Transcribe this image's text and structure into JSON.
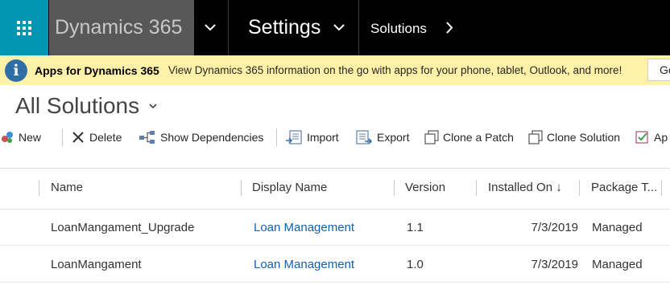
{
  "nav": {
    "brand": "Dynamics 365",
    "area": "Settings",
    "breadcrumb": "Solutions"
  },
  "banner": {
    "title": "Apps for Dynamics 365",
    "message": "View Dynamics 365 information on the go with apps for your phone, tablet, Outlook, and more!",
    "button_label": "Ge"
  },
  "view": {
    "title": "All Solutions"
  },
  "commands": {
    "new": "New",
    "delete": "Delete",
    "show_dependencies": "Show Dependencies",
    "import": "Import",
    "export": "Export",
    "clone_patch": "Clone a Patch",
    "clone_solution": "Clone Solution",
    "apply": "Ap"
  },
  "grid": {
    "columns": [
      "Name",
      "Display Name",
      "Version",
      "Installed On",
      "Package T..."
    ],
    "sort_indicator": "↓",
    "rows": [
      {
        "name": "LoanMangament_Upgrade",
        "display_name": "Loan Management",
        "version": "1.1",
        "installed_on": "7/3/2019",
        "package_type": "Managed"
      },
      {
        "name": "LoanMangament",
        "display_name": "Loan Management",
        "version": "1.0",
        "installed_on": "7/3/2019",
        "package_type": "Managed"
      }
    ]
  }
}
